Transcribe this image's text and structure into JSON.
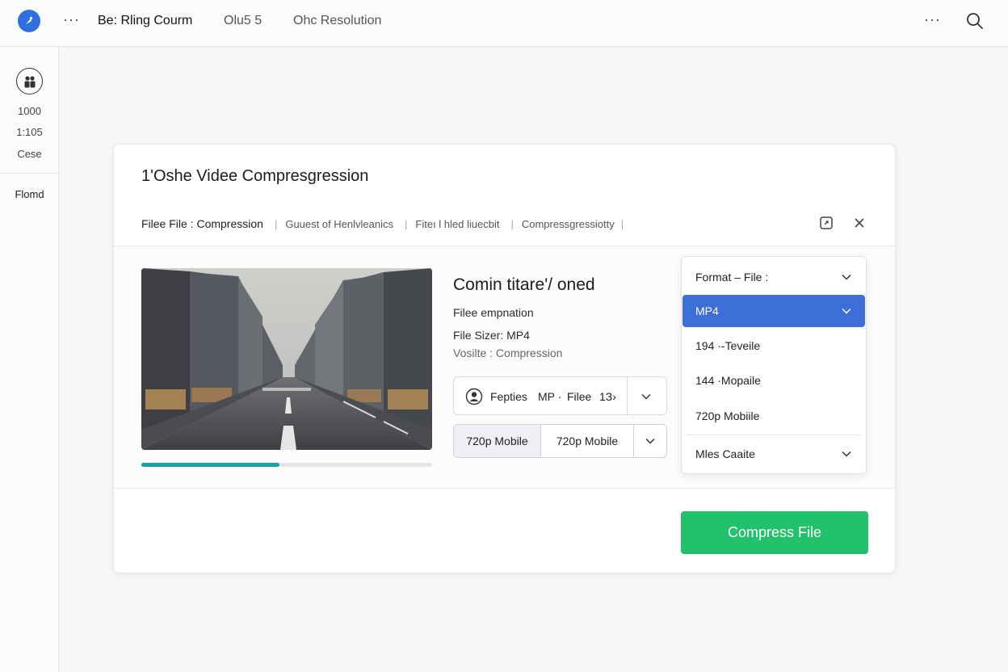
{
  "topbar": {
    "logo_glyph": "⁄",
    "tabs": [
      {
        "label": "Be: Rling Courm",
        "active": true
      },
      {
        "label": "Olu5 5",
        "active": false
      },
      {
        "label": "Ohc Resolution",
        "active": false
      }
    ],
    "menu_dots": "···"
  },
  "leftrail": {
    "items": [
      "1000",
      "1:105",
      "Cese"
    ],
    "section_label": "Flomd"
  },
  "dialog": {
    "title": "1'Oshe Videe Compresgression",
    "breadcrumbs": [
      "Filee File : Compression",
      "Guuest of Henlvleanics",
      "Fiteı l hled  liuecbit",
      "Compressgressiotty"
    ],
    "info": {
      "title": "Comin titare'/ oned",
      "line1": "Filee empnation",
      "line2": "File Sizer: MP4",
      "line3": "Vosilte : Compression"
    },
    "presets": {
      "label": "Fepties",
      "format": "MP ·",
      "file": "Filee",
      "count": "1З›"
    },
    "resolution": {
      "option_a": "720p Mobile",
      "option_b": "720p Mobile"
    },
    "format_dropdown": {
      "header": "Format  –  File :",
      "selected": "MP4",
      "options": [
        "194 ·-Teveile",
        "144 ·Mopaile",
        "720p Mobiile"
      ],
      "footer": "Mles Caaite"
    },
    "compress_label": "Compress File",
    "progress": 0.475
  },
  "colors": {
    "accent": "#3e6fd9",
    "compress": "#22c16b",
    "progress": "#16a3a5",
    "logo": "#2f6fe0"
  }
}
